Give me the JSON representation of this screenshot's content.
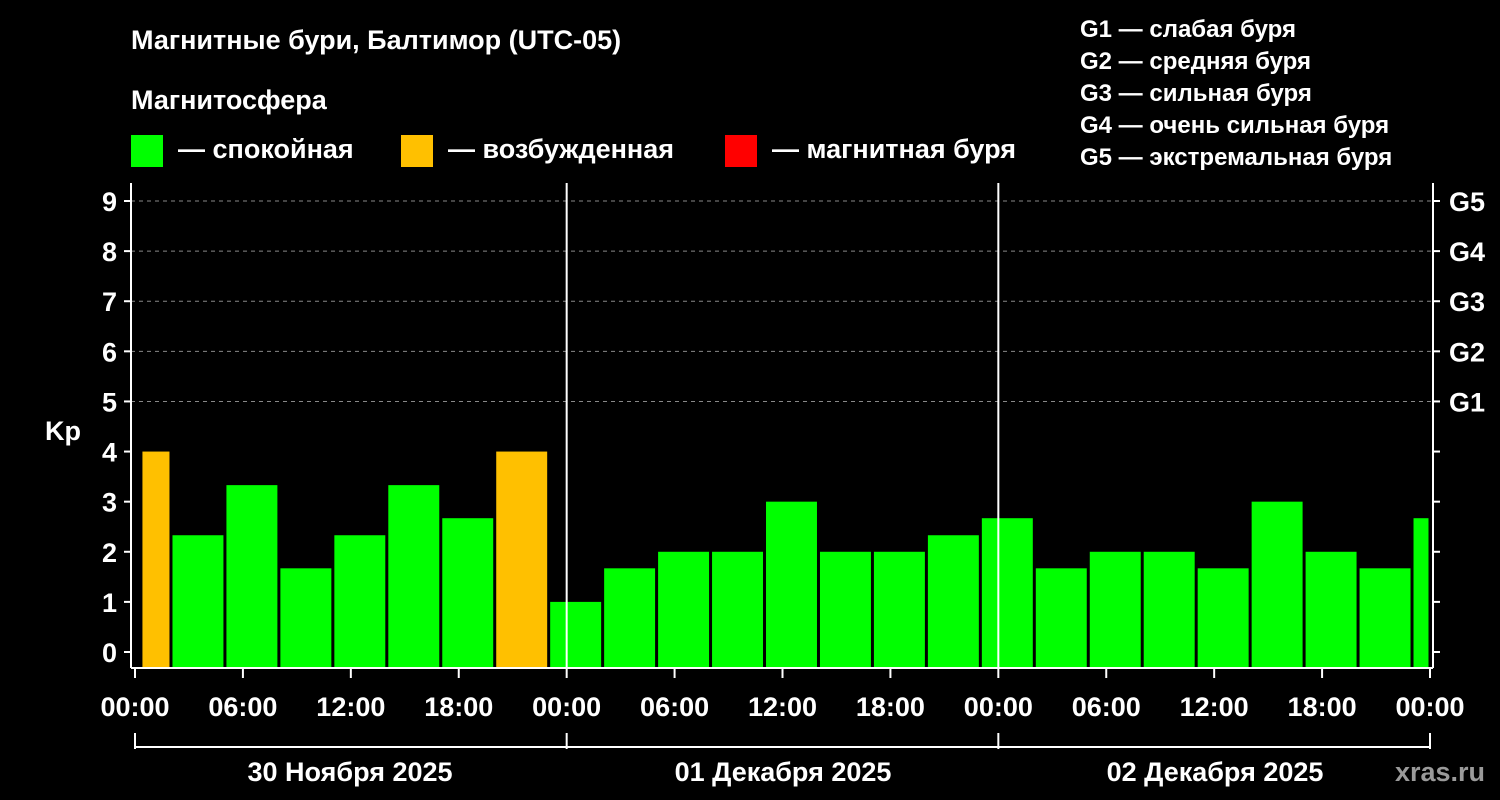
{
  "colors": {
    "background": "#000000",
    "quiet": "#00ff00",
    "excited": "#ffc000",
    "storm": "#ff0000",
    "axis": "#ffffff",
    "grid": "#888888",
    "watermark": "#9a9a9a"
  },
  "header": {
    "title": "Магнитные бури, Балтимор (UTC-05)",
    "subtitle": "Магнитосфера"
  },
  "legend": {
    "quiet_label": "— спокойная",
    "excited_label": "— возбужденная",
    "storm_label": "— магнитная буря"
  },
  "storm_scale": {
    "g1": "G1 — слабая буря",
    "g2": "G2 — средняя буря",
    "g3": "G3 — сильная буря",
    "g4": "G4 — очень сильная буря",
    "g5": "G5 — экстремальная буря"
  },
  "watermark": "xras.ru",
  "chart_data": {
    "type": "bar",
    "ylabel": "Kp",
    "ylim": [
      0,
      9
    ],
    "yticks": [
      "0",
      "1",
      "2",
      "3",
      "4",
      "5",
      "6",
      "7",
      "8",
      "9"
    ],
    "right_ticks": [
      {
        "value": 5,
        "label": "G1"
      },
      {
        "value": 6,
        "label": "G2"
      },
      {
        "value": 7,
        "label": "G3"
      },
      {
        "value": 8,
        "label": "G4"
      },
      {
        "value": 9,
        "label": "G5"
      }
    ],
    "x_tick_labels": [
      "00:00",
      "06:00",
      "12:00",
      "18:00",
      "00:00",
      "06:00",
      "12:00",
      "18:00",
      "00:00",
      "06:00",
      "12:00",
      "18:00",
      "00:00"
    ],
    "days": [
      "30 Ноября 2025",
      "01 Декабря 2025",
      "02 Декабря 2025"
    ],
    "grid": true,
    "bars": [
      {
        "start_hour": 0.33,
        "end_hour": 2,
        "kp": 4.0,
        "level": "excited"
      },
      {
        "start_hour": 2,
        "end_hour": 5,
        "kp": 2.33,
        "level": "quiet"
      },
      {
        "start_hour": 5,
        "end_hour": 8,
        "kp": 3.33,
        "level": "quiet"
      },
      {
        "start_hour": 8,
        "end_hour": 11,
        "kp": 1.67,
        "level": "quiet"
      },
      {
        "start_hour": 11,
        "end_hour": 14,
        "kp": 2.33,
        "level": "quiet"
      },
      {
        "start_hour": 14,
        "end_hour": 17,
        "kp": 3.33,
        "level": "quiet"
      },
      {
        "start_hour": 17,
        "end_hour": 20,
        "kp": 2.67,
        "level": "quiet"
      },
      {
        "start_hour": 20,
        "end_hour": 23,
        "kp": 4.0,
        "level": "excited"
      },
      {
        "start_hour": 23,
        "end_hour": 26,
        "kp": 1.0,
        "level": "quiet"
      },
      {
        "start_hour": 26,
        "end_hour": 29,
        "kp": 1.67,
        "level": "quiet"
      },
      {
        "start_hour": 29,
        "end_hour": 32,
        "kp": 2.0,
        "level": "quiet"
      },
      {
        "start_hour": 32,
        "end_hour": 35,
        "kp": 2.0,
        "level": "quiet"
      },
      {
        "start_hour": 35,
        "end_hour": 38,
        "kp": 3.0,
        "level": "quiet"
      },
      {
        "start_hour": 38,
        "end_hour": 41,
        "kp": 2.0,
        "level": "quiet"
      },
      {
        "start_hour": 41,
        "end_hour": 44,
        "kp": 2.0,
        "level": "quiet"
      },
      {
        "start_hour": 44,
        "end_hour": 47,
        "kp": 2.33,
        "level": "quiet"
      },
      {
        "start_hour": 47,
        "end_hour": 50,
        "kp": 2.67,
        "level": "quiet"
      },
      {
        "start_hour": 50,
        "end_hour": 53,
        "kp": 1.67,
        "level": "quiet"
      },
      {
        "start_hour": 53,
        "end_hour": 56,
        "kp": 2.0,
        "level": "quiet"
      },
      {
        "start_hour": 56,
        "end_hour": 59,
        "kp": 2.0,
        "level": "quiet"
      },
      {
        "start_hour": 59,
        "end_hour": 62,
        "kp": 1.67,
        "level": "quiet"
      },
      {
        "start_hour": 62,
        "end_hour": 65,
        "kp": 3.0,
        "level": "quiet"
      },
      {
        "start_hour": 65,
        "end_hour": 68,
        "kp": 2.0,
        "level": "quiet"
      },
      {
        "start_hour": 68,
        "end_hour": 71,
        "kp": 1.67,
        "level": "quiet"
      },
      {
        "start_hour": 71,
        "end_hour": 72,
        "kp": 2.67,
        "level": "quiet"
      }
    ]
  }
}
